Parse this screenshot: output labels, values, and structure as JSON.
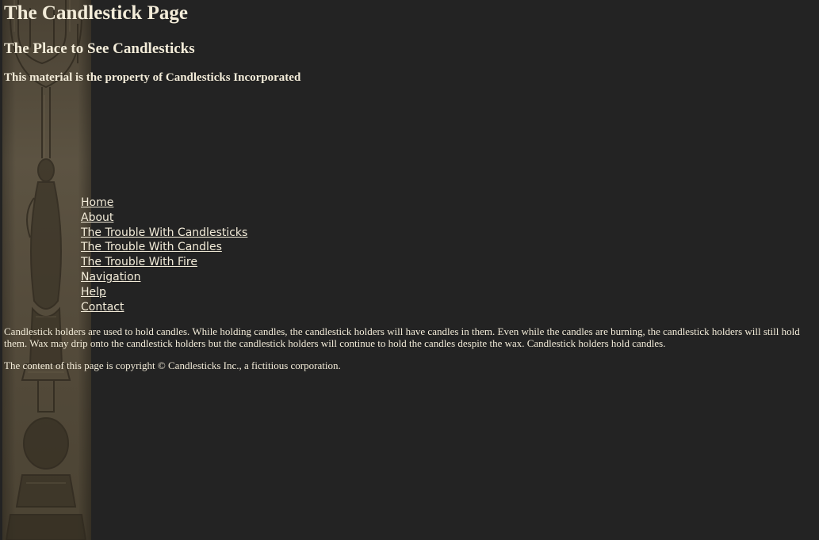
{
  "header": {
    "title": "The Candlestick Page",
    "subtitle": "The Place to See Candlesticks",
    "property_notice": "This material is the property of Candlesticks Incorporated"
  },
  "nav": {
    "links": [
      {
        "label": "Home"
      },
      {
        "label": "About"
      },
      {
        "label": "The Trouble With Candlesticks"
      },
      {
        "label": "The Trouble With Candles"
      },
      {
        "label": "The Trouble With Fire"
      },
      {
        "label": "Navigation"
      },
      {
        "label": "Help"
      },
      {
        "label": "Contact"
      }
    ]
  },
  "main": {
    "paragraph": "Candlestick holders are used to hold candles. While holding candles, the candlestick holders will have candles in them. Even while the candles are burning, the candlestick holders will still hold them. Wax may drip onto the candlestick holders but the candlestick holders will continue to hold the candles despite the wax. Candlestick holders hold candles.",
    "copyright": "The content of this page is copyright © Candlesticks Inc., a fictitious corporation."
  },
  "colors": {
    "background": "#232323",
    "text": "#f3ecd9"
  },
  "icons": {
    "side_art": "candlestick-illustration"
  }
}
